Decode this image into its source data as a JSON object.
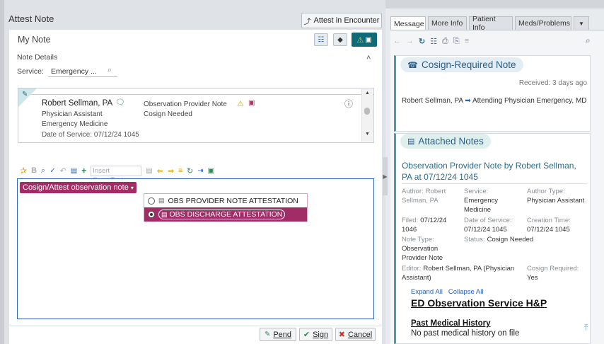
{
  "left": {
    "title": "Attest Note",
    "attest_in_encounter": "Attest in Encounter",
    "my_note": "My Note",
    "note_details": "Note Details",
    "service_label": "Service:",
    "service_value": "Emergency ...",
    "author_name": "Robert Sellman, PA",
    "author_role": "Physician Assistant",
    "author_dept": "Emergency Medicine",
    "note_type": "Observation Provider Note",
    "cosign_status": "Cosign Needed",
    "date_of_service": "Date of Service: 07/12/24 1045",
    "editor_toolbar": {
      "insert_smarttext_placeholder": "Insert SmartText"
    },
    "cosign_dropdown": "Cosign/Attest observation note",
    "menu_options": [
      {
        "label": "OBS PROVIDER NOTE ATTESTATION",
        "selected": false
      },
      {
        "label": "OBS DISCHARGE ATTESTATION",
        "selected": true
      }
    ],
    "buttons": {
      "pend": "Pend",
      "sign": "Sign",
      "cancel": "Cancel"
    }
  },
  "right": {
    "tabs": [
      "Message",
      "More Info",
      "Patient Info",
      "Meds/Problems"
    ],
    "card1": {
      "title": "Cosign-Required Note",
      "received": "Received: 3 days ago",
      "from": "Robert Sellman, PA",
      "to": "Attending Physician Emergency, MD"
    },
    "card2": {
      "title": "Attached Notes",
      "note_heading": "Observation Provider Note by Robert Sellman, PA at 07/12/24 1045",
      "author_label": "Author:",
      "author_value": "Robert Sellman, PA",
      "service_label": "Service:",
      "service_value": "Emergency Medicine",
      "author_type_label": "Author Type:",
      "author_type_value": "Physician Assistant",
      "filed_label": "Filed:",
      "filed_value": "07/12/24 1046",
      "dos_label": "Date of Service:",
      "dos_value": "07/12/24 1045",
      "creation_label": "Creation Time:",
      "creation_value": "07/12/24 1045",
      "note_type_label": "Note Type:",
      "note_type_value": "Observation Provider Note",
      "status_label": "Status:",
      "status_value": "Cosign Needed",
      "editor_label": "Editor:",
      "editor_value": "Robert Sellman, PA (Physician Assistant)",
      "cosign_req_label": "Cosign Required:",
      "cosign_req_value": "Yes",
      "expand_all": "Expand All",
      "collapse_all": "Collapse All",
      "section_title": "ED Observation Service H&P",
      "pmh_title": "Past Medical History",
      "pmh_text": "No past medical history on file"
    }
  },
  "colors": {
    "accent_magenta": "#a12c66",
    "teal": "#46a0a2",
    "link_blue": "#2563b6"
  }
}
